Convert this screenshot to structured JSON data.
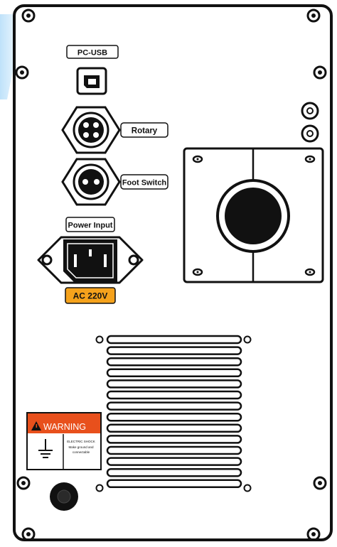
{
  "labels": {
    "pc_usb": "PC-USB",
    "rotary": "Rotary",
    "foot_switch": "Foot Switch",
    "power_input": "Power Input",
    "voltage": "AC 220V"
  },
  "warning": {
    "title": "WARNING",
    "line1": "ELECTRIC SHOCK",
    "line2": "Make ground and",
    "line3": "connectable"
  },
  "colors": {
    "panel_outline": "#111111",
    "voltage_badge": "#f5a21c",
    "warning_header": "#e8501c",
    "accent_glow": "#cfe9fb"
  },
  "icons": [
    "usb-b-port-icon",
    "4-pin-connector-icon",
    "2-pin-connector-icon",
    "iec-power-socket-icon",
    "warning-triangle-icon",
    "ground-symbol-icon",
    "round-port-icon"
  ]
}
